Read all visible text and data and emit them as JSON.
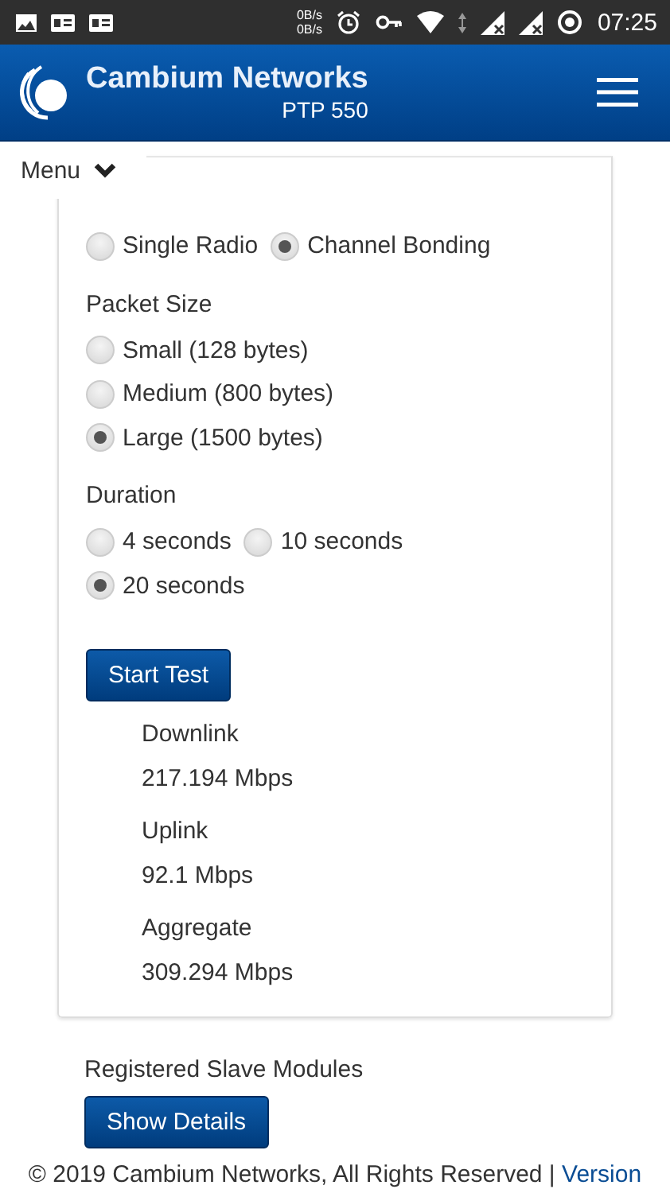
{
  "status_bar": {
    "speed_up": "0B/s",
    "speed_down": "0B/s",
    "time": "07:25"
  },
  "header": {
    "brand": "Cambium Networks",
    "product": "PTP 550"
  },
  "menu": {
    "label": "Menu"
  },
  "test_form": {
    "groups": [
      {
        "rows": [
          [
            {
              "label": "Single Radio",
              "selected": false
            },
            {
              "label": "Channel Bonding",
              "selected": true
            }
          ]
        ]
      },
      {
        "label": "Packet Size",
        "rows": [
          [
            {
              "label": "Small (128 bytes)",
              "selected": false
            }
          ],
          [
            {
              "label": "Medium (800 bytes)",
              "selected": false
            }
          ],
          [
            {
              "label": "Large (1500 bytes)",
              "selected": true
            }
          ]
        ]
      },
      {
        "label": "Duration",
        "rows": [
          [
            {
              "label": "4 seconds",
              "selected": false
            },
            {
              "label": "10 seconds",
              "selected": false
            }
          ],
          [
            {
              "label": "20 seconds",
              "selected": true
            }
          ]
        ]
      }
    ],
    "start_button": "Start Test",
    "results": [
      {
        "label": "Downlink",
        "value": "217.194 Mbps"
      },
      {
        "label": "Uplink",
        "value": "92.1 Mbps"
      },
      {
        "label": "Aggregate",
        "value": "309.294 Mbps"
      }
    ]
  },
  "registered": {
    "label": "Registered Slave Modules",
    "button": "Show Details"
  },
  "footer": {
    "text": "© 2019 Cambium Networks, All Rights Reserved |",
    "link": "Version"
  }
}
